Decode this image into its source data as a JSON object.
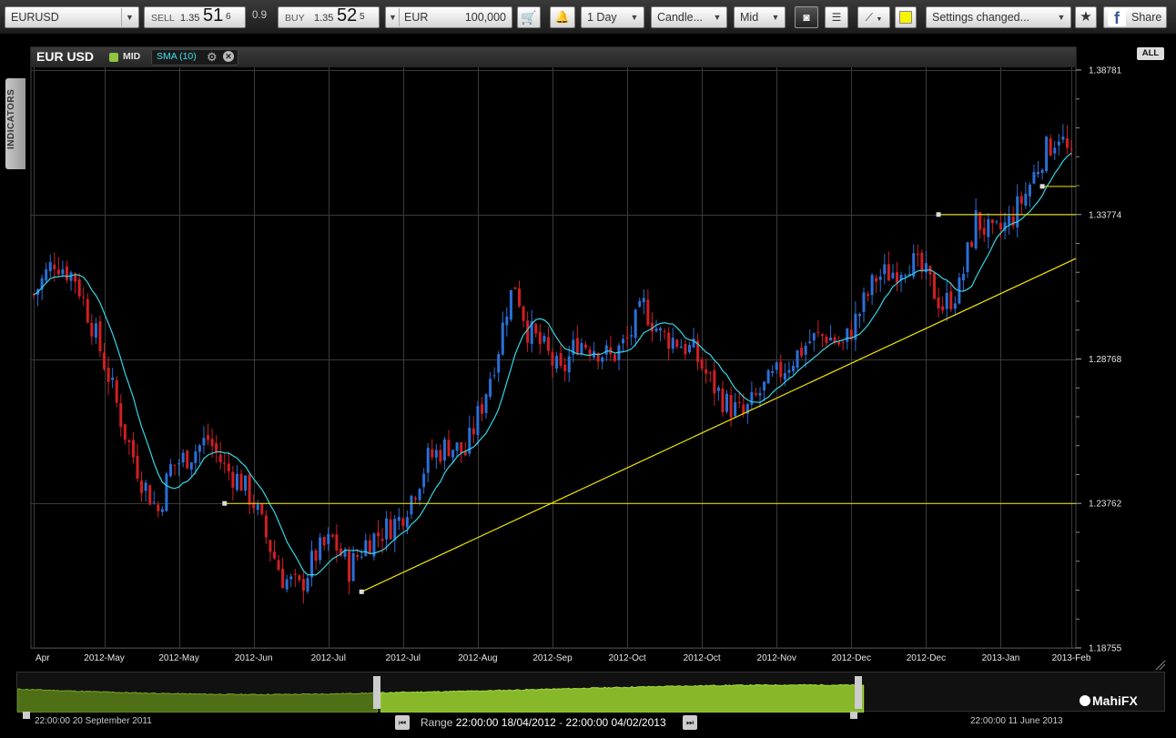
{
  "toolbar": {
    "symbol": "EURUSD",
    "sell_label": "SELL",
    "sell_prefix": "1.35",
    "sell_big": "51",
    "sell_pip": "6",
    "spread": "0.9",
    "buy_label": "BUY",
    "buy_prefix": "1.35",
    "buy_big": "52",
    "buy_pip": "5",
    "currency": "EUR",
    "amount": "100,000",
    "timeframe": "1 Day",
    "chart_type": "Candle...",
    "price_type": "Mid",
    "settings_status": "Settings changed...",
    "share_label": "Share",
    "facebook_glyph": "f"
  },
  "chart_header": {
    "symbol_title": "EUR USD",
    "mid_label": "MID",
    "sma_label": "SMA (10)",
    "gear_glyph": "⚙",
    "close_glyph": "✕"
  },
  "side": {
    "indicators_label": "INDICATORS",
    "all_label": "ALL"
  },
  "chart_data": {
    "type": "candlestick",
    "title": "EUR USD",
    "ylim": [
      1.18755,
      1.39
    ],
    "y_ticks": [
      1.38781,
      1.33774,
      1.28768,
      1.23762,
      1.18755
    ],
    "y_tick_labels": [
      "1.38781",
      "1.33774",
      "1.28768",
      "1.23762",
      "1.18755"
    ],
    "x_tick_labels": [
      "Apr",
      "2012-May",
      "2012-May",
      "2012-Jun",
      "2012-Jul",
      "2012-Jul",
      "2012-Aug",
      "2012-Sep",
      "2012-Oct",
      "2012-Oct",
      "2012-Nov",
      "2012-Dec",
      "2012-Dec",
      "2013-Jan",
      "2013-Feb"
    ],
    "x_start": "2012-04-18",
    "x_end": "2013-02-04",
    "close_path": [
      [
        0,
        1.31
      ],
      [
        5,
        1.322
      ],
      [
        10,
        1.316
      ],
      [
        14,
        1.3
      ],
      [
        18,
        1.282
      ],
      [
        22,
        1.262
      ],
      [
        26,
        1.246
      ],
      [
        30,
        1.235
      ],
      [
        33,
        1.25
      ],
      [
        38,
        1.255
      ],
      [
        42,
        1.26
      ],
      [
        46,
        1.25
      ],
      [
        50,
        1.245
      ],
      [
        53,
        1.238
      ],
      [
        56,
        1.226
      ],
      [
        60,
        1.212
      ],
      [
        64,
        1.208
      ],
      [
        68,
        1.22
      ],
      [
        72,
        1.225
      ],
      [
        76,
        1.215
      ],
      [
        80,
        1.224
      ],
      [
        84,
        1.228
      ],
      [
        88,
        1.232
      ],
      [
        91,
        1.24
      ],
      [
        95,
        1.253
      ],
      [
        100,
        1.258
      ],
      [
        104,
        1.255
      ],
      [
        108,
        1.272
      ],
      [
        112,
        1.292
      ],
      [
        114,
        1.306
      ],
      [
        116,
        1.314
      ],
      [
        119,
        1.298
      ],
      [
        123,
        1.291
      ],
      [
        127,
        1.282
      ],
      [
        131,
        1.294
      ],
      [
        135,
        1.292
      ],
      [
        139,
        1.288
      ],
      [
        143,
        1.294
      ],
      [
        147,
        1.306
      ],
      [
        151,
        1.296
      ],
      [
        155,
        1.294
      ],
      [
        159,
        1.29
      ],
      [
        163,
        1.28
      ],
      [
        167,
        1.272
      ],
      [
        171,
        1.268
      ],
      [
        175,
        1.276
      ],
      [
        179,
        1.282
      ],
      [
        183,
        1.288
      ],
      [
        187,
        1.294
      ],
      [
        191,
        1.296
      ],
      [
        195,
        1.292
      ],
      [
        199,
        1.304
      ],
      [
        203,
        1.316
      ],
      [
        207,
        1.318
      ],
      [
        211,
        1.322
      ],
      [
        215,
        1.316
      ],
      [
        219,
        1.306
      ],
      [
        223,
        1.312
      ],
      [
        227,
        1.336
      ],
      [
        231,
        1.33
      ],
      [
        235,
        1.335
      ],
      [
        239,
        1.345
      ],
      [
        243,
        1.358
      ],
      [
        247,
        1.366
      ],
      [
        250,
        1.356
      ]
    ],
    "series": [
      {
        "name": "SMA (10)",
        "color": "#35d6e6"
      }
    ],
    "annotations": [
      {
        "type": "horizontal_line",
        "y": 1.23762,
        "color": "#f2e600"
      },
      {
        "type": "horizontal_line",
        "y": 1.33774,
        "color": "#f2e600"
      },
      {
        "type": "horizontal_line",
        "y": 1.3475,
        "color": "#f2e600"
      },
      {
        "type": "trend_line",
        "from": [
          79,
          1.207
        ],
        "to": [
          "2013-02-04",
          1.3225
        ],
        "color": "#f2e600"
      }
    ],
    "colors": {
      "up": "#2b6fd6",
      "down": "#d01f24",
      "background": "#000000",
      "grid": "#3a3a3a"
    }
  },
  "navigator": {
    "range_label": "Range",
    "range_from": "22:00:00 18/04/2012",
    "range_sep": "-",
    "range_to": "22:00:00 04/02/2013",
    "left_date": "22:00:00 20 September 2011",
    "right_date": "22:00:00 11 June 2013",
    "brand": "MahiFX",
    "prev_glyph": "⏮",
    "next_glyph": "⏭"
  }
}
